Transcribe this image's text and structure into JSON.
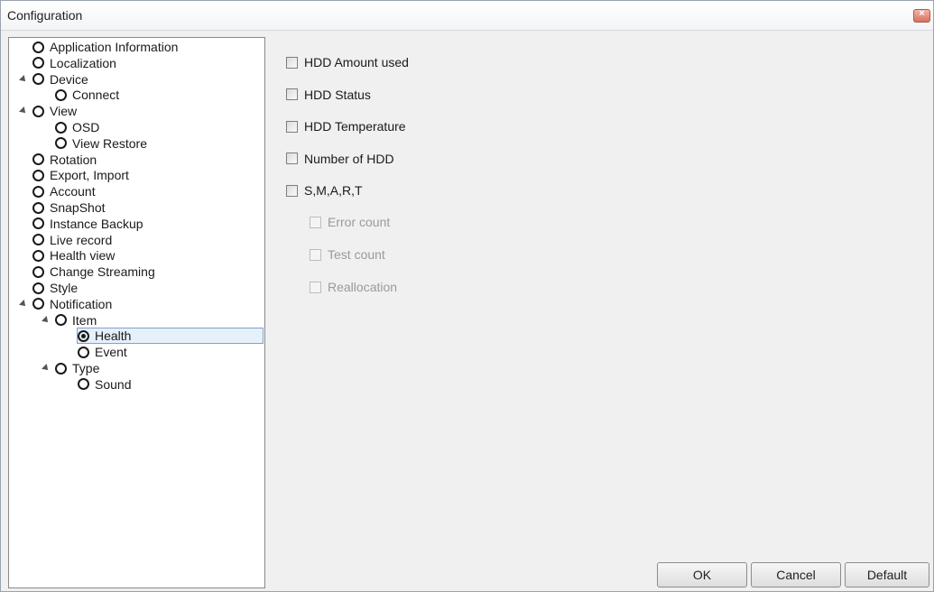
{
  "window": {
    "title": "Configuration",
    "close_icon": "close-icon"
  },
  "tree": [
    {
      "label": "Application Information",
      "indent": 0,
      "expander": false,
      "checked": false
    },
    {
      "label": "Localization",
      "indent": 0,
      "expander": false,
      "checked": false
    },
    {
      "label": "Device",
      "indent": 0,
      "expander": true,
      "checked": false
    },
    {
      "label": "Connect",
      "indent": 1,
      "expander": false,
      "checked": false
    },
    {
      "label": "View",
      "indent": 0,
      "expander": true,
      "checked": false
    },
    {
      "label": "OSD",
      "indent": 1,
      "expander": false,
      "checked": false
    },
    {
      "label": "View Restore",
      "indent": 1,
      "expander": false,
      "checked": false
    },
    {
      "label": "Rotation",
      "indent": 0,
      "expander": false,
      "checked": false
    },
    {
      "label": "Export, Import",
      "indent": 0,
      "expander": false,
      "checked": false
    },
    {
      "label": "Account",
      "indent": 0,
      "expander": false,
      "checked": false
    },
    {
      "label": "SnapShot",
      "indent": 0,
      "expander": false,
      "checked": false
    },
    {
      "label": "Instance Backup",
      "indent": 0,
      "expander": false,
      "checked": false
    },
    {
      "label": "Live record",
      "indent": 0,
      "expander": false,
      "checked": false
    },
    {
      "label": "Health view",
      "indent": 0,
      "expander": false,
      "checked": false
    },
    {
      "label": "Change Streaming",
      "indent": 0,
      "expander": false,
      "checked": false
    },
    {
      "label": "Style",
      "indent": 0,
      "expander": false,
      "checked": false
    },
    {
      "label": "Notification",
      "indent": 0,
      "expander": true,
      "checked": false
    },
    {
      "label": "Item",
      "indent": 1,
      "expander": true,
      "checked": false
    },
    {
      "label": "Health",
      "indent": 2,
      "expander": false,
      "checked": true,
      "selected": true
    },
    {
      "label": "Event",
      "indent": 2,
      "expander": false,
      "checked": false
    },
    {
      "label": "Type",
      "indent": 1,
      "expander": true,
      "checked": false
    },
    {
      "label": "Sound",
      "indent": 2,
      "expander": false,
      "checked": false
    }
  ],
  "options": [
    {
      "label": "HDD Amount used",
      "checked": false,
      "enabled": true
    },
    {
      "label": "HDD Status",
      "checked": false,
      "enabled": true
    },
    {
      "label": "HDD Temperature",
      "checked": false,
      "enabled": true
    },
    {
      "label": "Number of HDD",
      "checked": false,
      "enabled": true
    },
    {
      "label": "S,M,A,R,T",
      "checked": false,
      "enabled": true
    }
  ],
  "sub_options": [
    {
      "label": "Error count",
      "checked": false,
      "enabled": false
    },
    {
      "label": "Test count",
      "checked": false,
      "enabled": false
    },
    {
      "label": "Reallocation",
      "checked": false,
      "enabled": false
    }
  ],
  "buttons": {
    "ok": "OK",
    "cancel": "Cancel",
    "default": "Default"
  }
}
